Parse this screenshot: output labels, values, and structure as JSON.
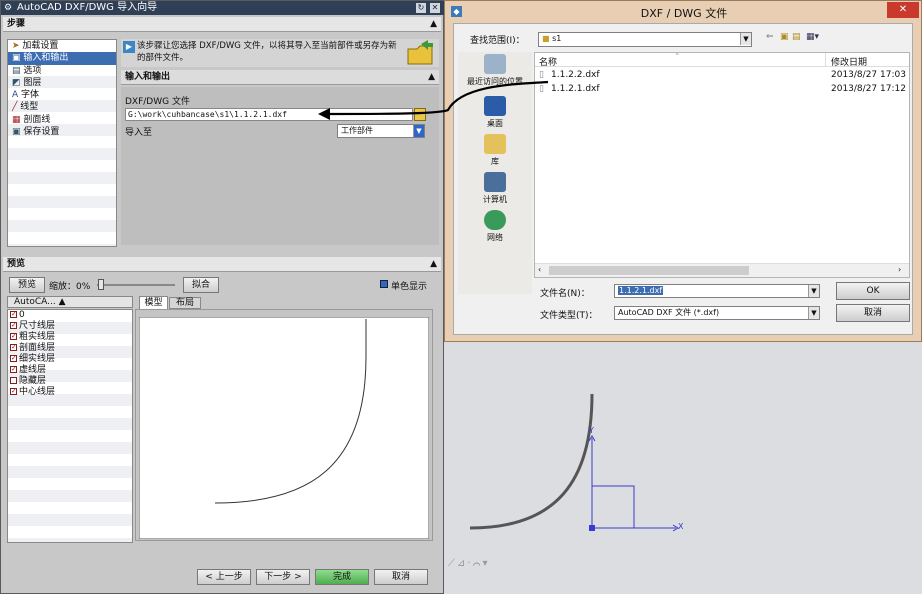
{
  "wizard": {
    "title": "AutoCAD DXF/DWG 导入向导",
    "steps_header": "步骤",
    "steps": [
      "加载设置",
      "输入和输出",
      "选项",
      "图层",
      "字体",
      "线型",
      "剖面线",
      "保存设置"
    ],
    "intro_text": "该步骤让您选择 DXF/DWG 文件，以将其导入至当前部件或另存为新的部件文件。",
    "io_section": "输入和输出",
    "file_label": "DXF/DWG 文件",
    "file_value": "G:\\work\\cuhbancase\\s1\\1.1.2.1.dxf",
    "import_to_label": "导入至",
    "import_to_value": "工作部件",
    "preview_header": "预览",
    "preview_button": "预览",
    "zoom_label": "缩放：0%",
    "fit_button": "拟合",
    "mono_label": "单色显示",
    "layer_col_header": "AutoCA... ▲",
    "layers": [
      "0",
      "尺寸线层",
      "粗实线层",
      "剖面线层",
      "细实线层",
      "虚线层",
      "隐藏层",
      "中心线层"
    ],
    "layers_checked": [
      true,
      true,
      true,
      true,
      true,
      true,
      false,
      true
    ],
    "tab_model": "模型",
    "tab_layout": "布局",
    "back_button": "< 上一步",
    "next_button": "下一步 >",
    "finish_button": "完成",
    "cancel_button": "取消"
  },
  "file_dialog": {
    "title": "DXF / DWG 文件",
    "look_in_label": "查找范围(I)：",
    "look_in_value": "s1",
    "col_name": "名称",
    "col_modified": "修改日期",
    "files": [
      {
        "name": "1.1.2.2.dxf",
        "modified": "2013/8/27 17:03"
      },
      {
        "name": "1.1.2.1.dxf",
        "modified": "2013/8/27 17:12"
      }
    ],
    "places": [
      "最近访问的位置",
      "桌面",
      "库",
      "计算机",
      "网络"
    ],
    "filename_label": "文件名(N)：",
    "filename_value": "1.1.2.1.dxf",
    "filetype_label": "文件类型(T)：",
    "filetype_value": "AutoCAD DXF 文件 (*.dxf)",
    "ok_button": "OK",
    "cancel_button": "取消"
  },
  "axes": {
    "x_label": "X",
    "y_label": "Y"
  },
  "accent_colors": {
    "selection": "#3b6db0",
    "finish": "#5cb85c",
    "axis": "#3a3ad0",
    "arrow": "#000000"
  }
}
